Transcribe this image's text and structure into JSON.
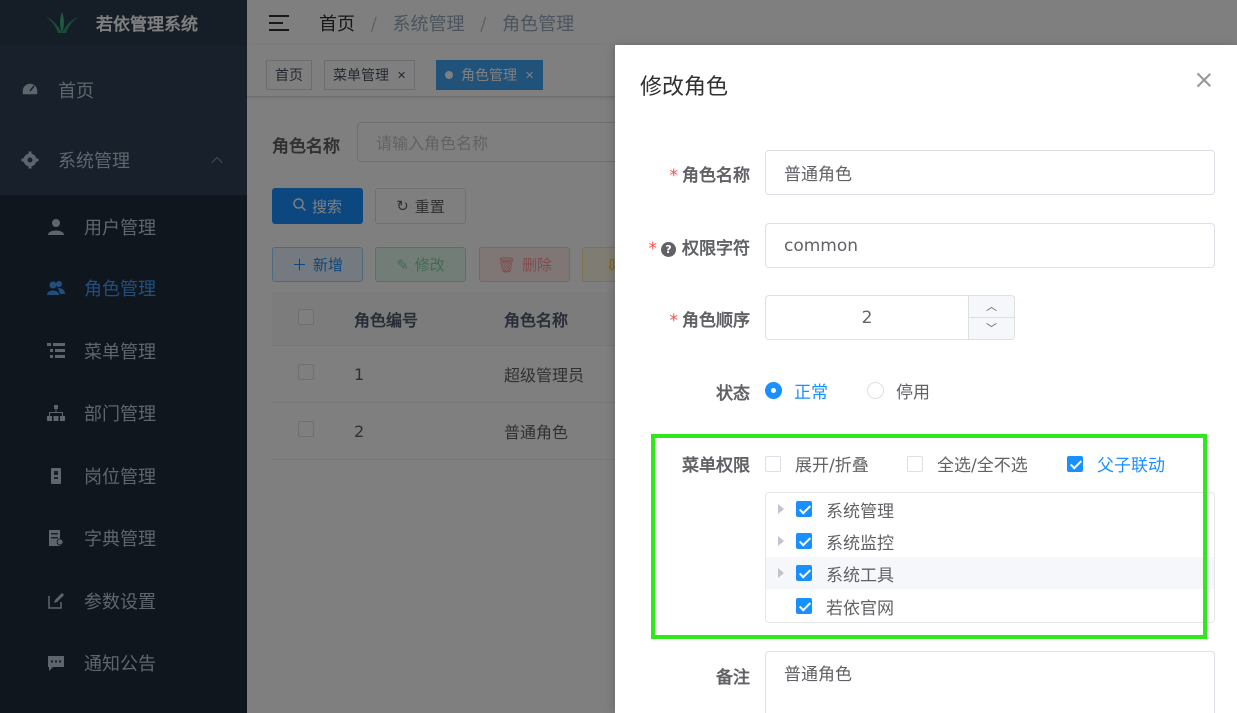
{
  "app": {
    "title": "若依管理系统"
  },
  "sidebar": {
    "items": [
      {
        "label": "首页",
        "icon": "dashboard-icon"
      },
      {
        "label": "系统管理",
        "icon": "gear-icon"
      },
      {
        "label": "用户管理",
        "icon": "user-icon"
      },
      {
        "label": "角色管理",
        "icon": "peoples-icon"
      },
      {
        "label": "菜单管理",
        "icon": "tree-table-icon"
      },
      {
        "label": "部门管理",
        "icon": "org-tree-icon"
      },
      {
        "label": "岗位管理",
        "icon": "post-icon"
      },
      {
        "label": "字典管理",
        "icon": "dict-icon"
      },
      {
        "label": "参数设置",
        "icon": "edit-icon"
      },
      {
        "label": "通知公告",
        "icon": "message-icon"
      }
    ]
  },
  "breadcrumb": {
    "home": "首页",
    "level1": "系统管理",
    "level2": "角色管理"
  },
  "tags": [
    {
      "label": "首页"
    },
    {
      "label": "菜单管理"
    },
    {
      "label": "角色管理"
    }
  ],
  "search": {
    "role_name_label": "角色名称",
    "role_name_placeholder": "请输入角色名称",
    "search_label": "搜索",
    "reset_label": "重置"
  },
  "toolbar": {
    "add": "新增",
    "edit": "修改",
    "delete": "删除"
  },
  "table": {
    "headers": [
      "角色编号",
      "角色名称"
    ],
    "rows": [
      {
        "id": "1",
        "name": "超级管理员"
      },
      {
        "id": "2",
        "name": "普通角色"
      }
    ]
  },
  "drawer": {
    "title": "修改角色",
    "role_name_label": "角色名称",
    "role_name_value": "普通角色",
    "perm_label": "权限字符",
    "perm_value": "common",
    "order_label": "角色顺序",
    "order_value": "2",
    "status_label": "状态",
    "status_options": [
      "正常",
      "停用"
    ],
    "menu_perm_label": "菜单权限",
    "expand_label": "展开/折叠",
    "select_all_label": "全选/全不选",
    "linkage_label": "父子联动",
    "tree_nodes": [
      "系统管理",
      "系统监控",
      "系统工具",
      "若依官网"
    ],
    "remark_label": "备注",
    "remark_value": "普通角色"
  },
  "colors": {
    "primary": "#1890ff",
    "sidebar_bg": "#304156",
    "highlight": "#2ee81a"
  }
}
